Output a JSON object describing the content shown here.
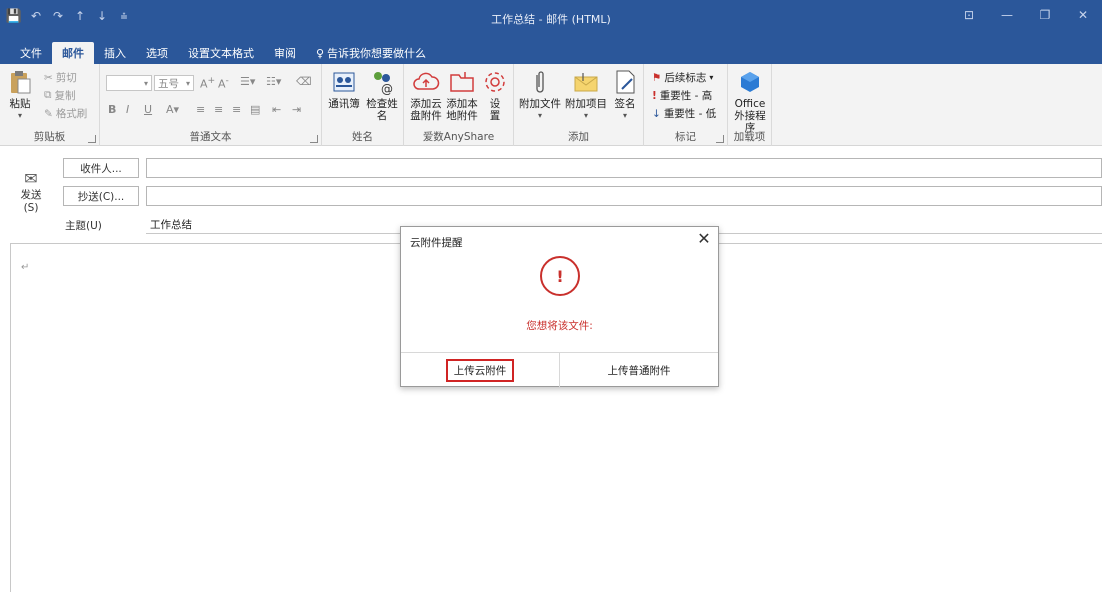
{
  "window": {
    "title": "工作总结 - 邮件 (HTML)"
  },
  "ribbon_tabs": [
    "文件",
    "邮件",
    "插入",
    "选项",
    "设置文本格式",
    "审阅",
    "告诉我你想要做什么"
  ],
  "clipboard": {
    "paste": "粘贴",
    "cut": "剪切",
    "copy": "复制",
    "format_painter": "格式刷",
    "group": "剪贴板"
  },
  "basic_text": {
    "font_size": "五号",
    "group": "普通文本"
  },
  "names": {
    "address_book": "通讯簿",
    "check_names": "检查姓名",
    "group": "姓名"
  },
  "anyshare": {
    "add_cloud_line1": "添加云",
    "add_cloud_line2": "盘附件",
    "add_local_line1": "添加本",
    "add_local_line2": "地附件",
    "settings_line1": "设",
    "settings_line2": "置",
    "group": "爱数AnyShare"
  },
  "include": {
    "attach_file": "附加文件",
    "attach_item": "附加项目",
    "signature": "签名",
    "group": "添加"
  },
  "tags": {
    "follow_up": "后续标志",
    "high_importance": "重要性 - 高",
    "low_importance": "重要性 - 低",
    "group": "标记"
  },
  "addins": {
    "office_line1": "Office",
    "office_line2": "外接程序",
    "group": "加载项"
  },
  "compose": {
    "send_line1": "发送",
    "send_line2": "(S)",
    "to_button": "收件人...",
    "cc_button": "抄送(C)...",
    "subject_label": "主题(U)",
    "subject_value": "工作总结",
    "body_mark": "↵"
  },
  "dialog": {
    "title": "云附件提醒",
    "warn_glyph": "!",
    "message": "您想将该文件:",
    "btn_cloud": "上传云附件",
    "btn_normal": "上传普通附件"
  }
}
